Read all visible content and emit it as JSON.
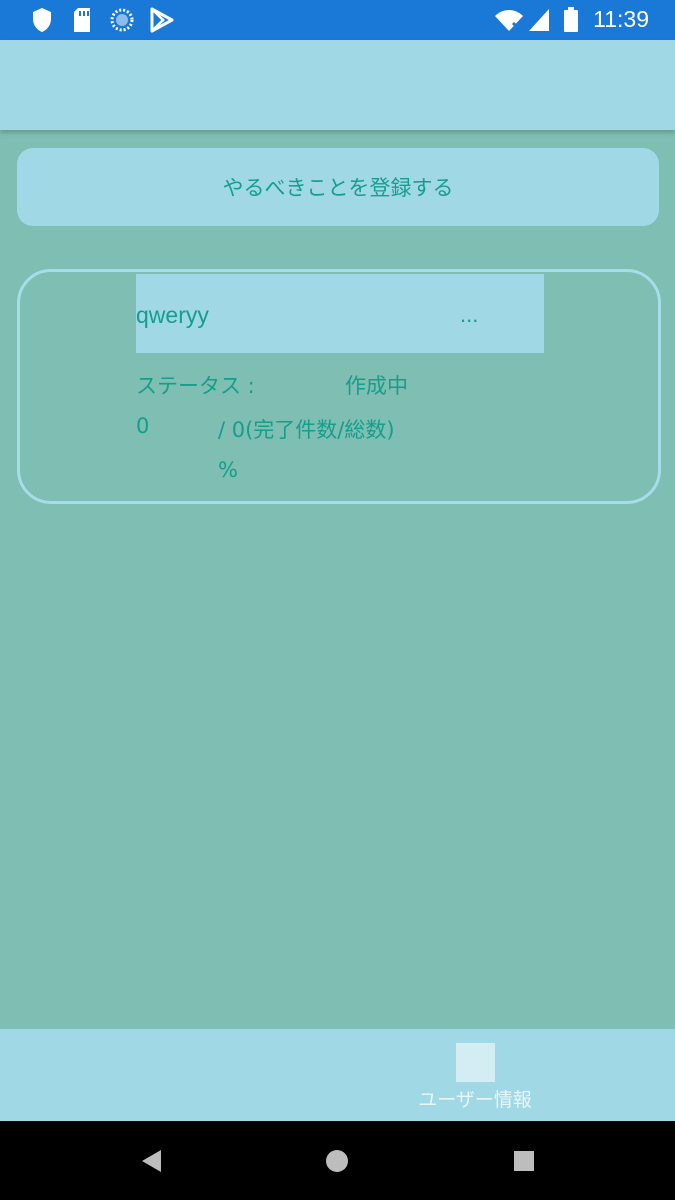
{
  "status_bar": {
    "time": "11:39",
    "icons": [
      "shield-icon",
      "sd-card-icon",
      "sync-icon",
      "play-store-icon",
      "wifi-icon",
      "signal-icon",
      "battery-icon"
    ]
  },
  "app_bar": {},
  "register_button": {
    "label": "やるべきことを登録する"
  },
  "task": {
    "title": "qweryy",
    "more": "...",
    "status_label": "ステータス :",
    "status_value": "作成中",
    "completed": "0",
    "total_text": "/ 0(完了件数/総数)",
    "percent": "%"
  },
  "bottom_nav": {
    "items": [
      {
        "label": "ユーザー情報",
        "icon": "user-info-icon"
      }
    ]
  },
  "system_nav": {
    "buttons": [
      "back-icon",
      "home-icon",
      "recents-icon"
    ]
  },
  "colors": {
    "status_bar": "#1a78d6",
    "app_bar": "#a0d8e6",
    "background": "#7fbeb2",
    "accent_text": "#159e8c",
    "card_border": "#a7dcea"
  }
}
